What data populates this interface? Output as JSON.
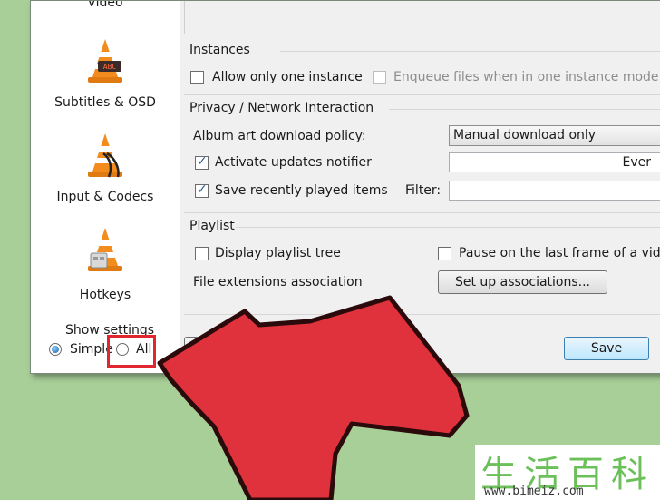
{
  "sidebar": {
    "items": [
      {
        "label": "Video",
        "icon": "vlc-cone-video-icon"
      },
      {
        "label": "Subtitles & OSD",
        "icon": "vlc-cone-subtitles-icon"
      },
      {
        "label": "Input & Codecs",
        "icon": "vlc-cone-input-icon"
      },
      {
        "label": "Hotkeys",
        "icon": "vlc-cone-hotkeys-icon"
      }
    ],
    "show_settings_label": "Show settings",
    "simple_label": "Simple",
    "all_label": "All"
  },
  "instances": {
    "title": "Instances",
    "allow_one_label": "Allow only one instance",
    "enqueue_label": "Enqueue files when in one instance mode"
  },
  "privacy": {
    "title": "Privacy / Network Interaction",
    "album_art_label": "Album art download policy:",
    "album_art_value": "Manual download only",
    "updates_label": "Activate updates notifier",
    "updates_value": "Ever",
    "recent_label": "Save recently played items",
    "filter_label": "Filter:"
  },
  "playlist": {
    "title": "Playlist",
    "tree_label": "Display playlist tree",
    "pause_label": "Pause on the last frame of a video",
    "assoc_label": "File extensions association",
    "assoc_button": "Set up associations..."
  },
  "footer": {
    "reset_partial": "R",
    "save_label": "Save"
  },
  "watermark": {
    "chars": "生活百科",
    "url": "www.bimeiz.com"
  },
  "colors": {
    "arrow": "#e0323c",
    "background": "#a8cf98",
    "accent": "#3c7fb1"
  }
}
